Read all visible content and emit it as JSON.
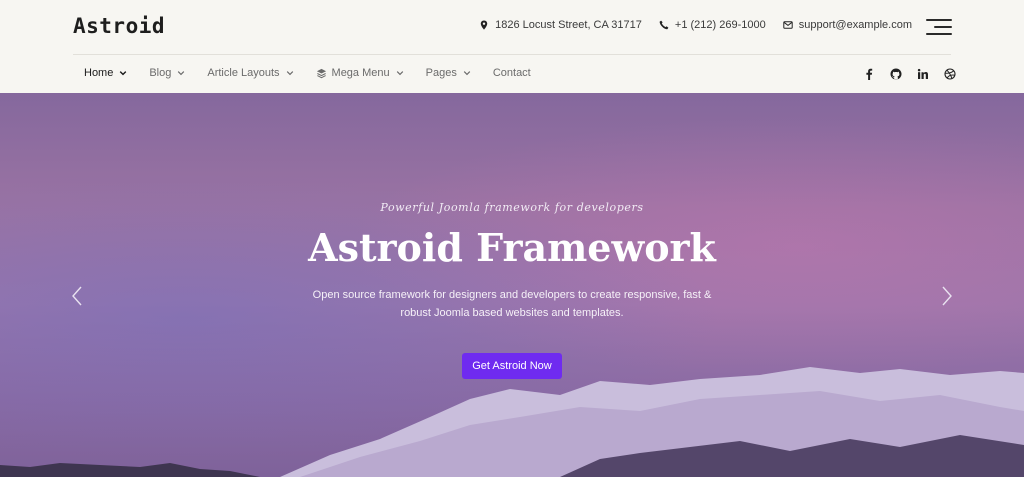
{
  "header": {
    "logo": "Astroid",
    "address": "1826 Locust Street, CA 31717",
    "phone": "+1 (212) 269-1000",
    "email": "support@example.com"
  },
  "nav": {
    "items": [
      {
        "label": "Home",
        "icon": "",
        "dropdown": true,
        "active": true
      },
      {
        "label": "Blog",
        "icon": "",
        "dropdown": true,
        "active": false
      },
      {
        "label": "Article Layouts",
        "icon": "",
        "dropdown": true,
        "active": false
      },
      {
        "label": "Mega Menu",
        "icon": "layers-icon",
        "dropdown": true,
        "active": false
      },
      {
        "label": "Pages",
        "icon": "",
        "dropdown": true,
        "active": false
      },
      {
        "label": "Contact",
        "icon": "",
        "dropdown": false,
        "active": false
      }
    ],
    "social": [
      "facebook-icon",
      "github-icon",
      "linkedin-icon",
      "dribbble-icon"
    ]
  },
  "hero": {
    "tagline": "Powerful Joomla framework for developers",
    "title": "Astroid Framework",
    "description": "Open source framework for designers and developers to create responsive, fast & robust Joomla based websites and templates.",
    "cta_label": "Get Astroid Now"
  },
  "colors": {
    "accent": "#6f2bf0",
    "background": "#f7f6f2",
    "hero_base": "#9c76aa"
  }
}
